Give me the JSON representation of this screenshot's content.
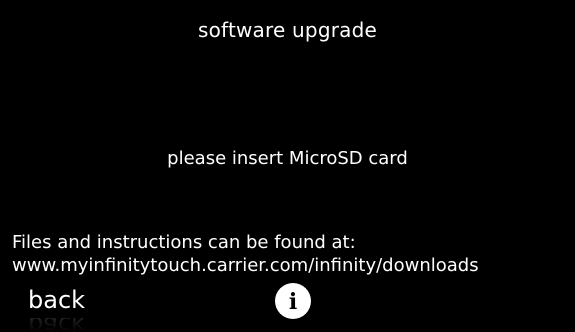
{
  "screen": {
    "title": "software upgrade",
    "message": "please insert MicroSD card",
    "info_line_1": "Files and instructions can be found at:",
    "info_line_2": "www.myinfinitytouch.carrier.com/infinity/downloads"
  },
  "footer": {
    "back_label": "back",
    "info_button_glyph": "i",
    "info_icon": "info-icon"
  },
  "colors": {
    "background": "#000000",
    "text": "#ffffff",
    "info_button_bg": "#ffffff"
  }
}
